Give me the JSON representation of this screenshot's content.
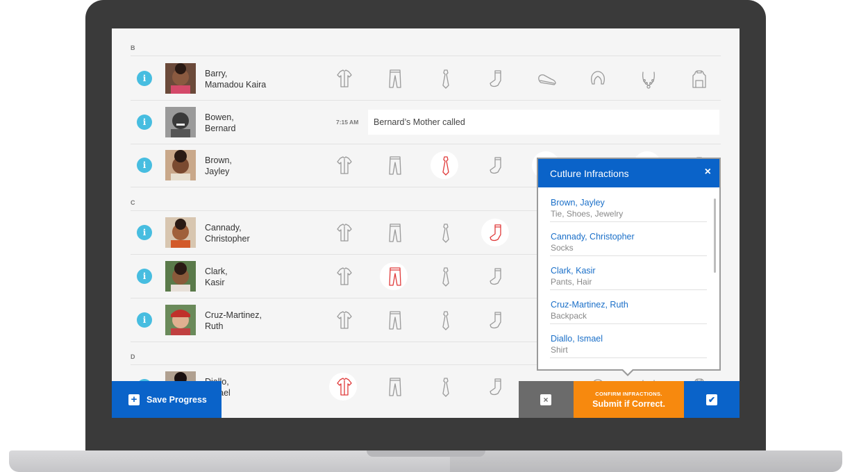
{
  "sections": [
    {
      "letter": "B"
    },
    {
      "letter": "C"
    },
    {
      "letter": "D"
    }
  ],
  "students": [
    {
      "last": "Barry,",
      "first": "Mamadou Kaira",
      "infractions": []
    },
    {
      "last": "Bowen,",
      "first": "Bernard",
      "note_time": "7:15 AM",
      "note": "Bernard’s Mother called"
    },
    {
      "last": "Brown,",
      "first": "Jayley",
      "infractions": [
        "tie",
        "shoes",
        "jewelry"
      ]
    },
    {
      "last": "Cannady,",
      "first": "Christopher",
      "infractions": [
        "socks"
      ]
    },
    {
      "last": "Clark,",
      "first": "Kasir",
      "infractions": [
        "pants",
        "hair"
      ]
    },
    {
      "last": "Cruz-Martinez,",
      "first": "Ruth",
      "infractions": [
        "backpack"
      ]
    },
    {
      "last": "Diallo,",
      "first": "Ismael",
      "infractions": [
        "shirt"
      ]
    }
  ],
  "uniform_icons": [
    "shirt-icon",
    "pants-icon",
    "tie-icon",
    "sock-icon",
    "shoe-icon",
    "hair-icon",
    "jewelry-icon",
    "backpack-icon"
  ],
  "popup": {
    "title": "Cutlure Infractions",
    "close": "×",
    "items": [
      {
        "name": "Brown, Jayley",
        "desc": "Tie, Shoes, Jewelry"
      },
      {
        "name": "Cannady, Christopher",
        "desc": "Socks"
      },
      {
        "name": "Clark, Kasir",
        "desc": "Pants, Hair"
      },
      {
        "name": "Cruz-Martinez, Ruth",
        "desc": "Backpack"
      },
      {
        "name": "Diallo, Ismael",
        "desc": "Shirt"
      }
    ]
  },
  "bottom_bar": {
    "save_label": "Save Progress",
    "save_icon": "+",
    "cancel_icon": "×",
    "confirm_small": "CONFIRM INFRACTIONS.",
    "confirm_big": "Submit if Correct.",
    "ok_icon": "✔"
  },
  "colors": {
    "accent_blue": "#0a63c9",
    "info_blue": "#47bde0",
    "infraction_red": "#e03a3a",
    "confirm_orange": "#f7890e",
    "cancel_gray": "#6b6b6b"
  }
}
